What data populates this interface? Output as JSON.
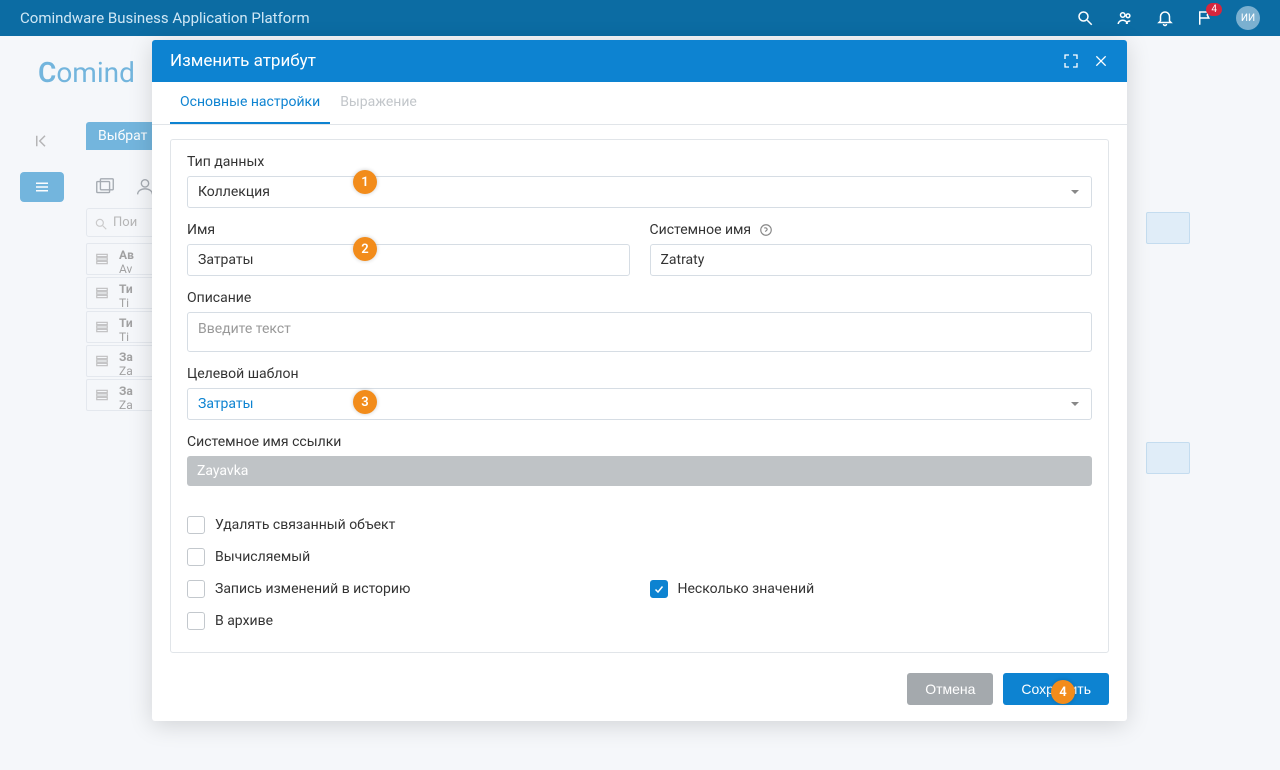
{
  "header": {
    "title": "Comindware Business Application Platform",
    "badge_count": "4",
    "avatar": "ИИ"
  },
  "background": {
    "logo": "Comind",
    "tab": "Выбрат",
    "search_placeholder": "Пои"
  },
  "modal": {
    "title": "Изменить атрибут",
    "tabs": {
      "main": "Основные настройки",
      "expression": "Выражение"
    },
    "fields": {
      "data_type": {
        "label": "Тип данных",
        "value": "Коллекция"
      },
      "name": {
        "label": "Имя",
        "value": "Затраты"
      },
      "sys_name": {
        "label": "Системное имя",
        "value": "Zatraty"
      },
      "description": {
        "label": "Описание",
        "placeholder": "Введите текст"
      },
      "target_template": {
        "label": "Целевой шаблон",
        "value": "Затраты"
      },
      "link_sys_name": {
        "label": "Системное имя ссылки",
        "value": "Zayavka"
      }
    },
    "checks": {
      "delete_related": "Удалять связанный объект",
      "computed": "Вычисляемый",
      "audit": "Запись изменений в историю",
      "multiple": "Несколько значений",
      "archived": "В архиве"
    },
    "buttons": {
      "cancel": "Отмена",
      "save": "Сохранить"
    }
  },
  "annotations": {
    "a1": "1",
    "a2": "2",
    "a3": "3",
    "a4": "4"
  },
  "bg_rows": {
    "r1t": "Ав",
    "r1s": "Av",
    "r2t": "Ти",
    "r2s": "Ti",
    "r3t": "Ти",
    "r3s": "Ti",
    "r4t": "За",
    "r4s": "Za",
    "r5t": "За",
    "r5s": "Za"
  }
}
